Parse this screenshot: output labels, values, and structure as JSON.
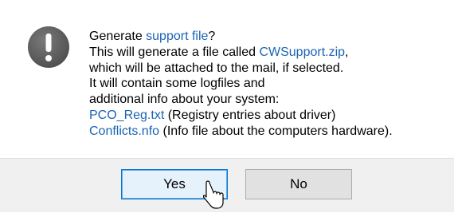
{
  "dialog": {
    "icon": "exclamation-icon",
    "lines": [
      {
        "before": "Generate ",
        "link": "support file",
        "after": "?"
      },
      {
        "before": "This will generate a file called ",
        "link": "CWSupport.zip",
        "after": ","
      },
      {
        "before": "which will be attached to the mail, if selected.",
        "link": "",
        "after": ""
      },
      {
        "before": "It will contain some logfiles and",
        "link": "",
        "after": ""
      },
      {
        "before": "additional info about your system:",
        "link": "",
        "after": ""
      },
      {
        "before": "",
        "link": "PCO_Reg.txt",
        "after": " (Registry entries about driver)"
      },
      {
        "before": "",
        "link": "Conflicts.nfo",
        "after": " (Info file about the computers hardware)."
      }
    ]
  },
  "buttons": {
    "yes_label": "Yes",
    "no_label": "No"
  },
  "colors": {
    "link": "#1a64b4",
    "icon_fill": "#5a5a5a",
    "focus_border": "#0078d7"
  }
}
